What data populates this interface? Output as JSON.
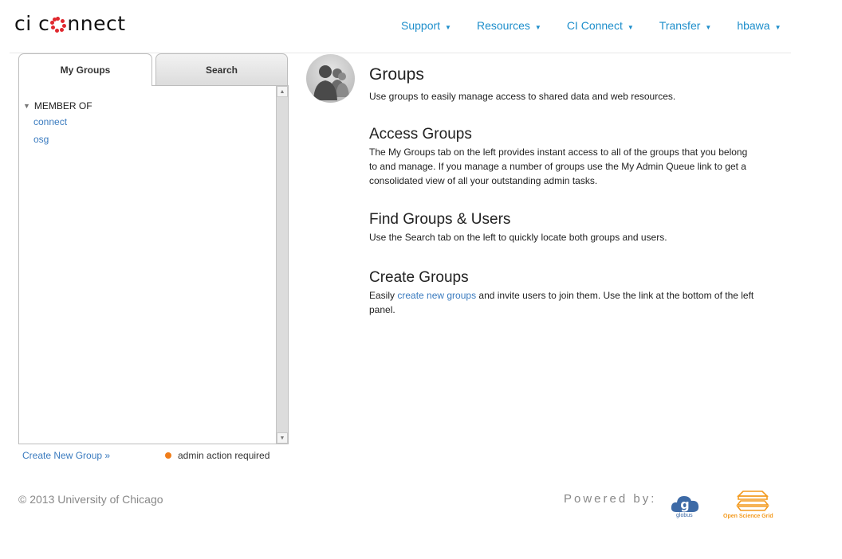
{
  "brand": {
    "logo_text_left": "ci c",
    "logo_text_right": "nnect"
  },
  "nav": [
    {
      "label": "Support"
    },
    {
      "label": "Resources"
    },
    {
      "label": "CI Connect"
    },
    {
      "label": "Transfer"
    },
    {
      "label": "hbawa"
    }
  ],
  "nav_caret": "▼",
  "left_panel": {
    "tabs": {
      "my_groups": "My Groups",
      "search": "Search"
    },
    "tree_header": "MEMBER OF",
    "groups": [
      "connect",
      "osg"
    ],
    "create_link": "Create New Group »",
    "legend_label": "admin action required"
  },
  "content": {
    "groups_title": "Groups",
    "groups_text": "Use groups to easily manage access to shared data and web resources.",
    "access_title": "Access Groups",
    "access_text": "The My Groups tab on the left provides instant access to all of the groups that you belong to and manage. If you manage a number of groups use the My Admin Queue link to get a consolidated view of all your outstanding admin tasks.",
    "find_title": "Find Groups & Users",
    "find_text": "Use the Search tab on the left to quickly locate both groups and users.",
    "create_title": "Create Groups",
    "create_text_before": "Easily ",
    "create_text_link": "create new groups",
    "create_text_after": " and invite users to join them. Use the link at the bottom of the left panel."
  },
  "footer": {
    "copyright": "© 2013 University of Chicago",
    "powered_by": "Powered by:",
    "globus_caption": "globus",
    "osg_caption": "Open Science Grid"
  },
  "colors": {
    "link": "#1d8ecb",
    "logo_accent": "#e0282e",
    "admin_dot": "#f07d1a",
    "osg_orange": "#f39a1e"
  }
}
